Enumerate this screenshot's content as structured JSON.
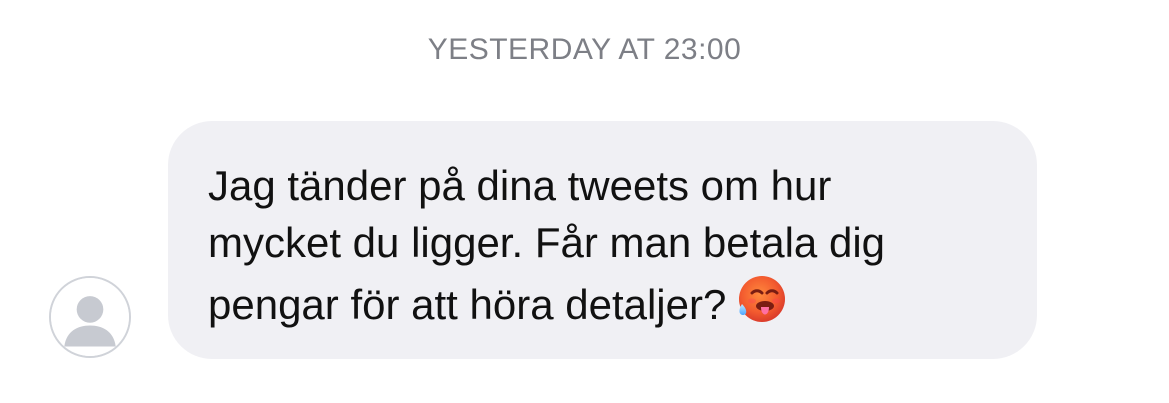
{
  "conversation": {
    "timestamp": "YESTERDAY AT 23:00",
    "message": {
      "lines": [
        "Jag tänder på dina tweets om hur",
        "mycket du ligger. Får man betala dig",
        "pengar för att höra detaljer?"
      ],
      "emoji": "hot-face-emoji"
    },
    "sender_avatar": "default-user-avatar"
  },
  "colors": {
    "timestamp_text": "#7d7f86",
    "bubble_background": "#f0f0f4",
    "message_text": "#111111",
    "avatar_gray": "#c7cad1"
  }
}
